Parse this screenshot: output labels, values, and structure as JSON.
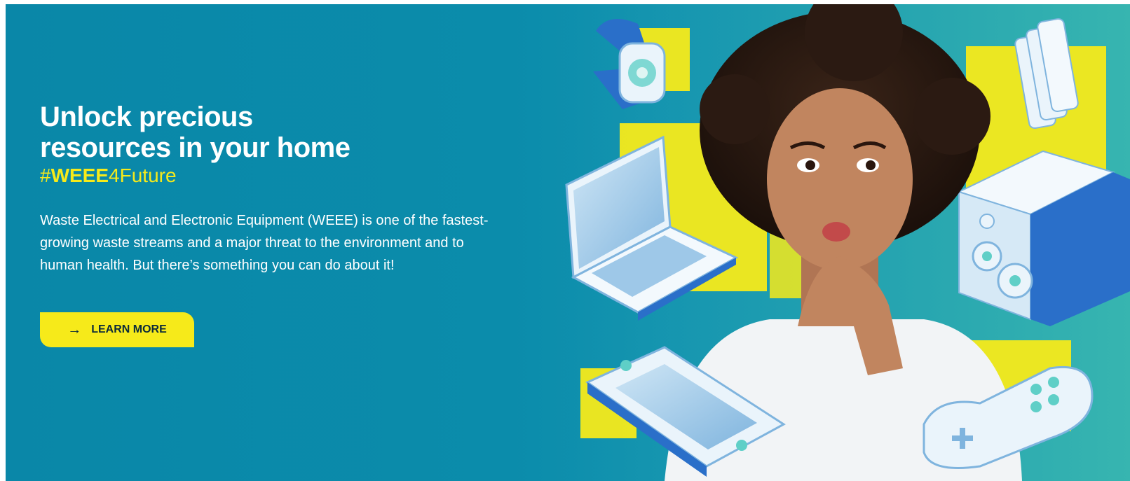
{
  "hero": {
    "title_line1": "Unlock precious",
    "title_line2": "resources in your home",
    "hashtag_prefix": "#",
    "hashtag_bold": "WEEE",
    "hashtag_rest": "4Future",
    "description": "Waste Electrical and Electronic Equipment (WEEE) is one of the fastest-growing waste streams and a major threat to the environment and to human health. But there’s something you can do about it!",
    "cta_label": "LEARN MORE",
    "cta_icon": "arrow-right-icon"
  },
  "colors": {
    "background": "#0b8cab",
    "accent_yellow": "#f6ea1a",
    "text_light": "#ffffff",
    "cta_text": "#0b2a3a"
  },
  "illustration": {
    "subject": "woman-thinking",
    "devices": [
      "smartwatch-icon",
      "laptop-icon",
      "smartphone-stack-icon",
      "speaker-icon",
      "handheld-console-icon",
      "game-controller-icon"
    ]
  }
}
